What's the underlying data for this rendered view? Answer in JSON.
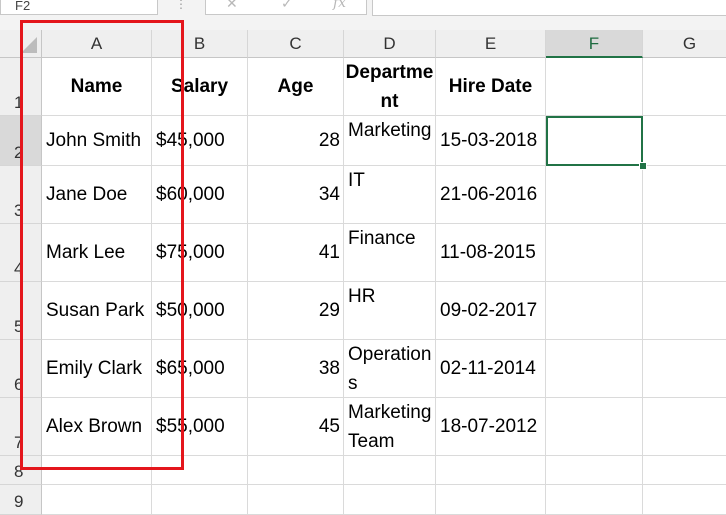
{
  "formula_bar": {
    "name_box": "F2",
    "cancel_icon": "✕",
    "enter_icon": "✓",
    "fx_label": "fx",
    "formula_value": ""
  },
  "columns": [
    "A",
    "B",
    "C",
    "D",
    "E",
    "F",
    "G"
  ],
  "rows": [
    "1",
    "2",
    "3",
    "4",
    "5",
    "6",
    "7",
    "8",
    "9"
  ],
  "table": {
    "headers": [
      "Name",
      "Salary",
      "Age",
      "Department",
      "Hire Date"
    ],
    "data": [
      [
        "John Smith",
        "$45,000",
        "28",
        "Marketing",
        "15-03-2018"
      ],
      [
        "Jane Doe",
        "$60,000",
        "34",
        "IT",
        "21-06-2016"
      ],
      [
        "Mark Lee",
        "$75,000",
        "41",
        "Finance",
        "11-08-2015"
      ],
      [
        "Susan Park",
        "$50,000",
        "29",
        "HR",
        "09-02-2017"
      ],
      [
        "Emily Clark",
        "$65,000",
        "38",
        "Operations",
        "02-11-2014"
      ],
      [
        "Alex Brown",
        "$55,000",
        "45",
        "Marketing Team",
        "18-07-2012"
      ]
    ]
  },
  "selected_cell": "F2",
  "highlight_color": "#e4161c",
  "accent_color": "#217346"
}
